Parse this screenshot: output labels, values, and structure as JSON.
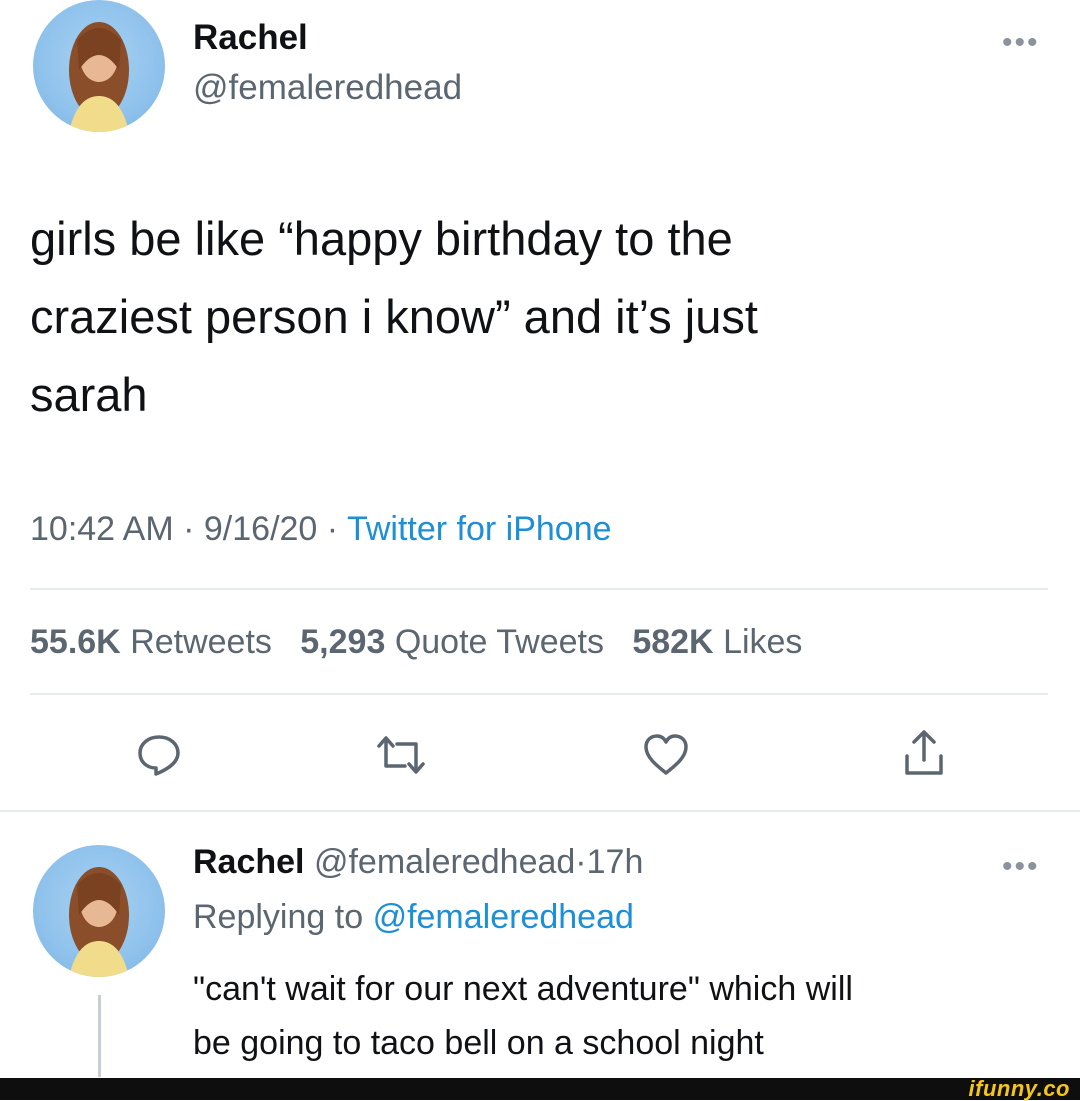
{
  "tweet": {
    "author_name": "Rachel",
    "author_handle": "@femaleredhead",
    "text_lines": [
      "girls be like “happy birthday to the",
      "craziest person i know” and it’s just",
      "sarah"
    ],
    "time": "10:42 AM",
    "separator": "·",
    "date": "9/16/20",
    "source": "Twitter for iPhone",
    "stats": {
      "retweets_count": "55.6K",
      "retweets_label": "Retweets",
      "quotes_count": "5,293",
      "quotes_label": "Quote Tweets",
      "likes_count": "582K",
      "likes_label": "Likes"
    },
    "more": "•••"
  },
  "actions": {
    "icons": [
      "reply-icon",
      "retweet-icon",
      "like-icon",
      "share-icon"
    ]
  },
  "reply": {
    "author_name": "Rachel",
    "author_handle": "@femaleredhead",
    "separator": "·",
    "age": "17h",
    "replying_prefix": "Replying to",
    "replying_handle": "@femaleredhead",
    "text_lines": [
      "\"can't wait for our next adventure\" which will",
      "be going to taco bell on a school night"
    ],
    "more": "•••"
  },
  "watermark": {
    "text": "ifunny.co",
    "color": "#f5c518"
  },
  "colors": {
    "link_blue": "#1d8fd6",
    "secondary_gray": "#5b6670"
  }
}
